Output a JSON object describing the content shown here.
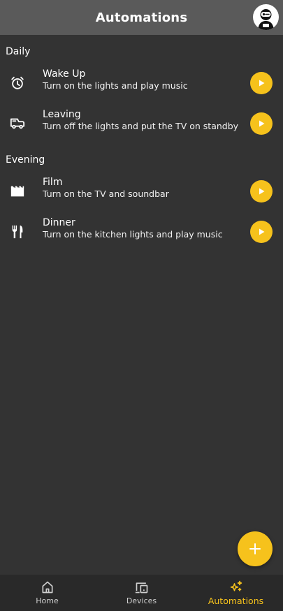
{
  "header": {
    "title": "Automations"
  },
  "sections": [
    {
      "title": "Daily",
      "items": [
        {
          "name": "Wake Up",
          "description": "Turn on the lights and play music",
          "icon": "alarm-icon"
        },
        {
          "name": "Leaving",
          "description": "Turn off the lights and put the TV on standby",
          "icon": "car-icon"
        }
      ]
    },
    {
      "title": "Evening",
      "items": [
        {
          "name": "Film",
          "description": "Turn on the TV and soundbar",
          "icon": "movie-icon"
        },
        {
          "name": "Dinner",
          "description": "Turn on the kitchen lights and play music",
          "icon": "utensils-icon"
        }
      ]
    }
  ],
  "nav": {
    "items": [
      {
        "label": "Home",
        "icon": "home-icon"
      },
      {
        "label": "Devices",
        "icon": "devices-icon"
      },
      {
        "label": "Automations",
        "icon": "sparkles-icon",
        "active": true
      }
    ]
  },
  "colors": {
    "background": "#333333",
    "header": "#5a5a5a",
    "accent": "#f6c21c",
    "nav_background": "#292929"
  }
}
